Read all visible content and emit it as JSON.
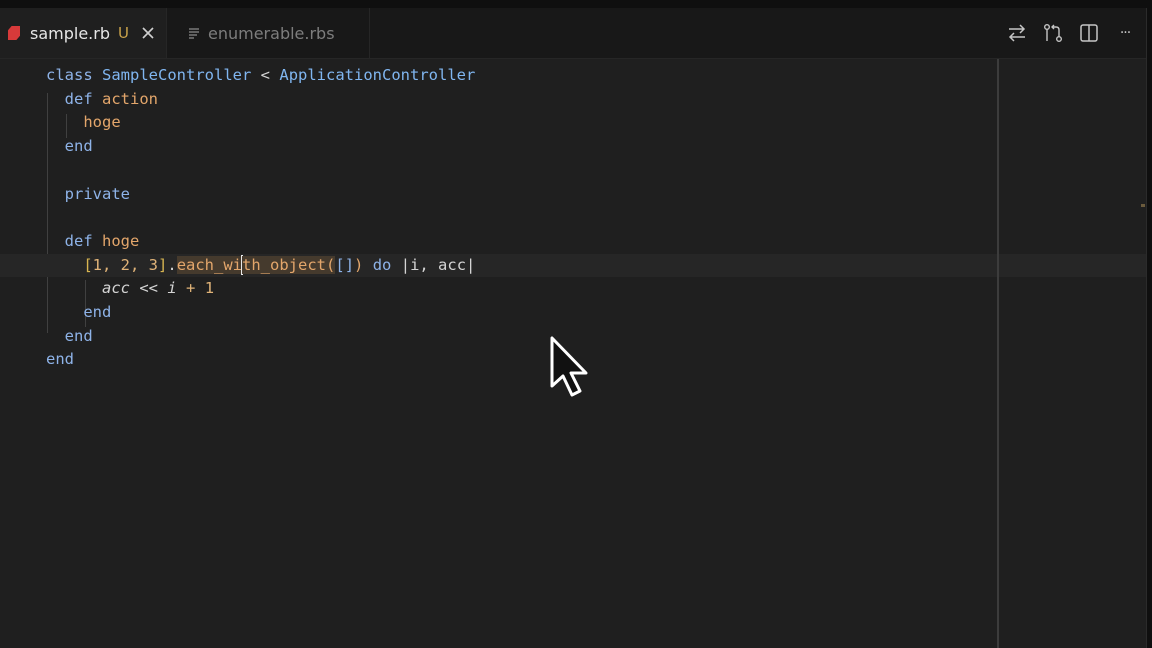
{
  "tabs": [
    {
      "label": "sample.rb",
      "status": "U",
      "icon": "ruby-file-icon"
    },
    {
      "label": "enumerable.rbs",
      "icon": "text-file-icon"
    }
  ],
  "toolbar": {
    "icons": [
      "compare-changes-icon",
      "source-control-icon",
      "split-editor-icon",
      "more-actions-icon"
    ],
    "more_label": "···"
  },
  "code": {
    "l1": {
      "kw": "class",
      "name": "SampleController",
      "op": "<",
      "parent": "ApplicationController"
    },
    "l2": {
      "kw": "def",
      "name": "action"
    },
    "l3": {
      "call": "hoge"
    },
    "l4": {
      "kw": "end"
    },
    "l6": {
      "kw": "private"
    },
    "l8": {
      "kw": "def",
      "name": "hoge"
    },
    "l9": {
      "open": "[",
      "items": "1, 2, 3",
      "close": "]",
      "dot": ".",
      "method_before_caret": "each_wi",
      "method_after_caret": "th_object",
      "paren_open": "(",
      "arr": "[]",
      "paren_close": ")",
      "do": "do",
      "block_params": "|i, acc|"
    },
    "l10": {
      "var": "acc",
      "op": "<<",
      "var2": "i",
      "rest": "+ 1"
    },
    "l11": {
      "kw": "end"
    },
    "l12": {
      "kw": "end"
    },
    "l13": {
      "kw": "end"
    }
  },
  "colors": {
    "keyword": "#8eb3e8",
    "class_name": "#80b6f0",
    "method_name": "#e3a66b",
    "bracket": "#d7b450",
    "modified": "#c9a24a",
    "ruby_icon": "#d73a3a"
  }
}
